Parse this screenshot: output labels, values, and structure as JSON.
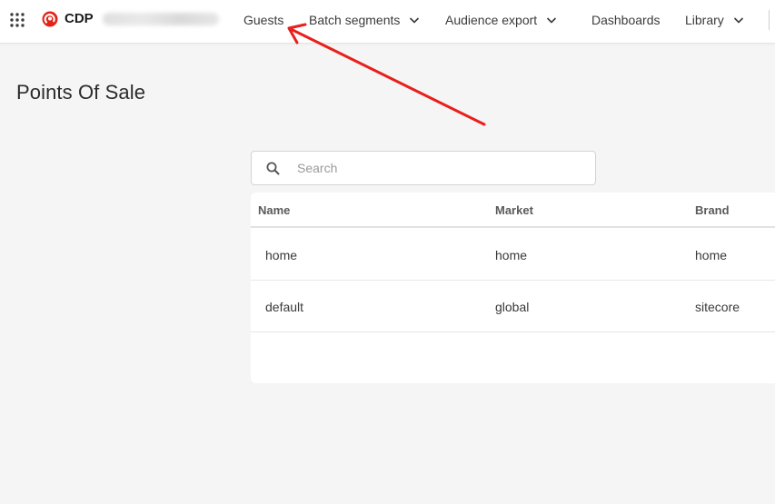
{
  "app": {
    "name": "CDP"
  },
  "icons": {
    "apps": "apps-grid-icon",
    "logo": "sitecore-logo-icon",
    "search": "search-icon",
    "chevron": "chevron-down-icon"
  },
  "colors": {
    "brand": "#e2231a",
    "annotation": "#e8201b"
  },
  "nav": {
    "guests": "Guests",
    "batch_segments": "Batch segments",
    "audience_export": "Audience export",
    "dashboards": "Dashboards",
    "library": "Library"
  },
  "page": {
    "title": "Points Of Sale"
  },
  "search": {
    "placeholder": "Search",
    "value": ""
  },
  "table": {
    "columns": [
      "Name",
      "Market",
      "Brand"
    ],
    "rows": [
      {
        "name": "home",
        "market": "home",
        "brand": "home"
      },
      {
        "name": "default",
        "market": "global",
        "brand": "sitecore"
      }
    ]
  }
}
